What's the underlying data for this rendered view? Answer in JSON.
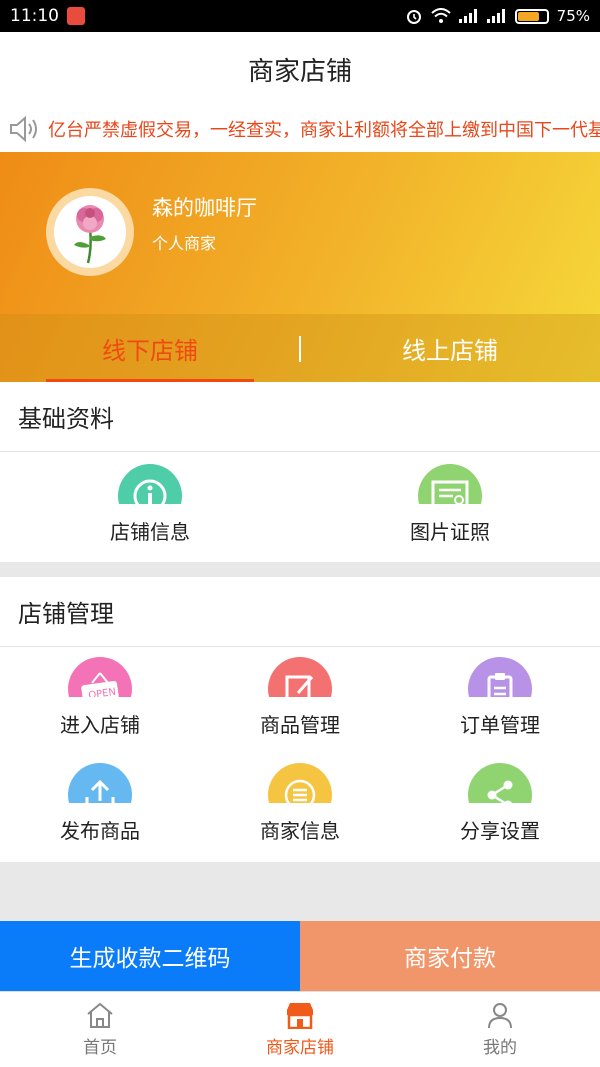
{
  "status_bar": {
    "time": "11:10",
    "battery": "75%",
    "battery_level": 0.75
  },
  "header": {
    "title": "商家店铺"
  },
  "notice": {
    "text": "亿台严禁虚假交易，一经查实，商家让利额将全部上缴到中国下一代基"
  },
  "profile": {
    "name": "森的咖啡厅",
    "type": "个人商家"
  },
  "tabs": [
    {
      "label": "线下店铺"
    },
    {
      "label": "线上店铺"
    }
  ],
  "basic": {
    "title": "基础资料",
    "items": [
      {
        "label": "店铺信息",
        "icon": "info-icon",
        "color": "#4ecda8"
      },
      {
        "label": "图片证照",
        "icon": "certificate-icon",
        "color": "#8fd470"
      }
    ]
  },
  "manage": {
    "title": "店铺管理",
    "items": [
      {
        "label": "进入店铺",
        "icon": "open-sign-icon",
        "color": "#f472b6"
      },
      {
        "label": "商品管理",
        "icon": "edit-icon",
        "color": "#f47171"
      },
      {
        "label": "订单管理",
        "icon": "clipboard-icon",
        "color": "#b892e6"
      },
      {
        "label": "发布商品",
        "icon": "upload-icon",
        "color": "#66b8f0"
      },
      {
        "label": "商家信息",
        "icon": "list-icon",
        "color": "#f5c542"
      },
      {
        "label": "分享设置",
        "icon": "share-icon",
        "color": "#8fd470"
      }
    ]
  },
  "actions": {
    "qr": "生成收款二维码",
    "pay": "商家付款"
  },
  "tabbar": [
    {
      "label": "首页",
      "icon": "home-icon"
    },
    {
      "label": "商家店铺",
      "icon": "shop-icon"
    },
    {
      "label": "我的",
      "icon": "user-icon"
    }
  ]
}
